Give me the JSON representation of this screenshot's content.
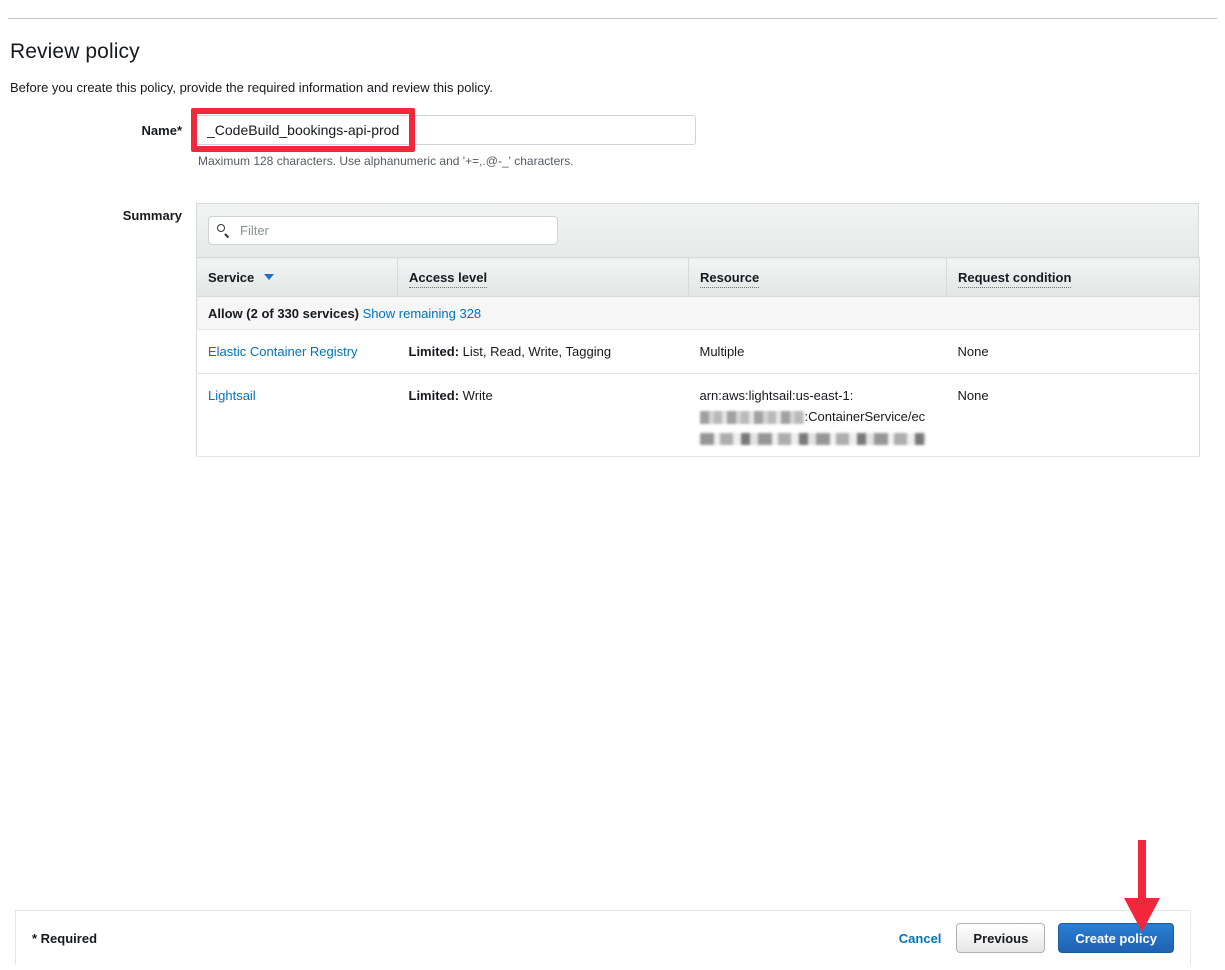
{
  "page": {
    "title": "Review policy",
    "subtitle": "Before you create this policy, provide the required information and review this policy."
  },
  "form": {
    "name_label": "Name*",
    "name_value": "_CodeBuild_bookings-api-prod",
    "name_placeholder": "",
    "name_hint": "Maximum 128 characters. Use alphanumeric and '+=,.@-_' characters.",
    "summary_label": "Summary"
  },
  "summary": {
    "filter_placeholder": "Filter",
    "filter_value": "",
    "search_icon": "search-icon",
    "sort_icon": "caret-down-icon",
    "columns": [
      {
        "label": "Service",
        "sorted": true,
        "dotted": false
      },
      {
        "label": "Access level",
        "sorted": false,
        "dotted": true
      },
      {
        "label": "Resource",
        "sorted": false,
        "dotted": true
      },
      {
        "label": "Request condition",
        "sorted": false,
        "dotted": true
      }
    ],
    "group": {
      "title": "Allow (2 of 330 services)",
      "show_remaining_link": "Show remaining 328"
    },
    "rows": [
      {
        "service": "Elastic Container Registry",
        "access_level_label": "Limited:",
        "access_level_value": " List, Read, Write, Tagging",
        "resource": "Multiple",
        "resource_redacted": false,
        "request_condition": "None"
      },
      {
        "service": "Lightsail",
        "access_level_label": "Limited:",
        "access_level_value": " Write",
        "resource_prefix": "arn:aws:lightsail:us-east-1:",
        "resource_suffix": ":ContainerService/ec",
        "resource_redacted": true,
        "request_condition": "None"
      }
    ]
  },
  "footer": {
    "required_note": "* Required",
    "cancel_label": "Cancel",
    "previous_label": "Previous",
    "create_label": "Create policy"
  },
  "annotations": {
    "highlight_color": "#f2273c",
    "arrow_color": "#f2273c",
    "arrow_icon": "arrow-down-icon",
    "highlight_target": "name-input",
    "arrow_target": "create-policy-button"
  },
  "colors": {
    "link": "#0073bb",
    "primary_button": "#2a7fd4",
    "text": "#16191f"
  }
}
